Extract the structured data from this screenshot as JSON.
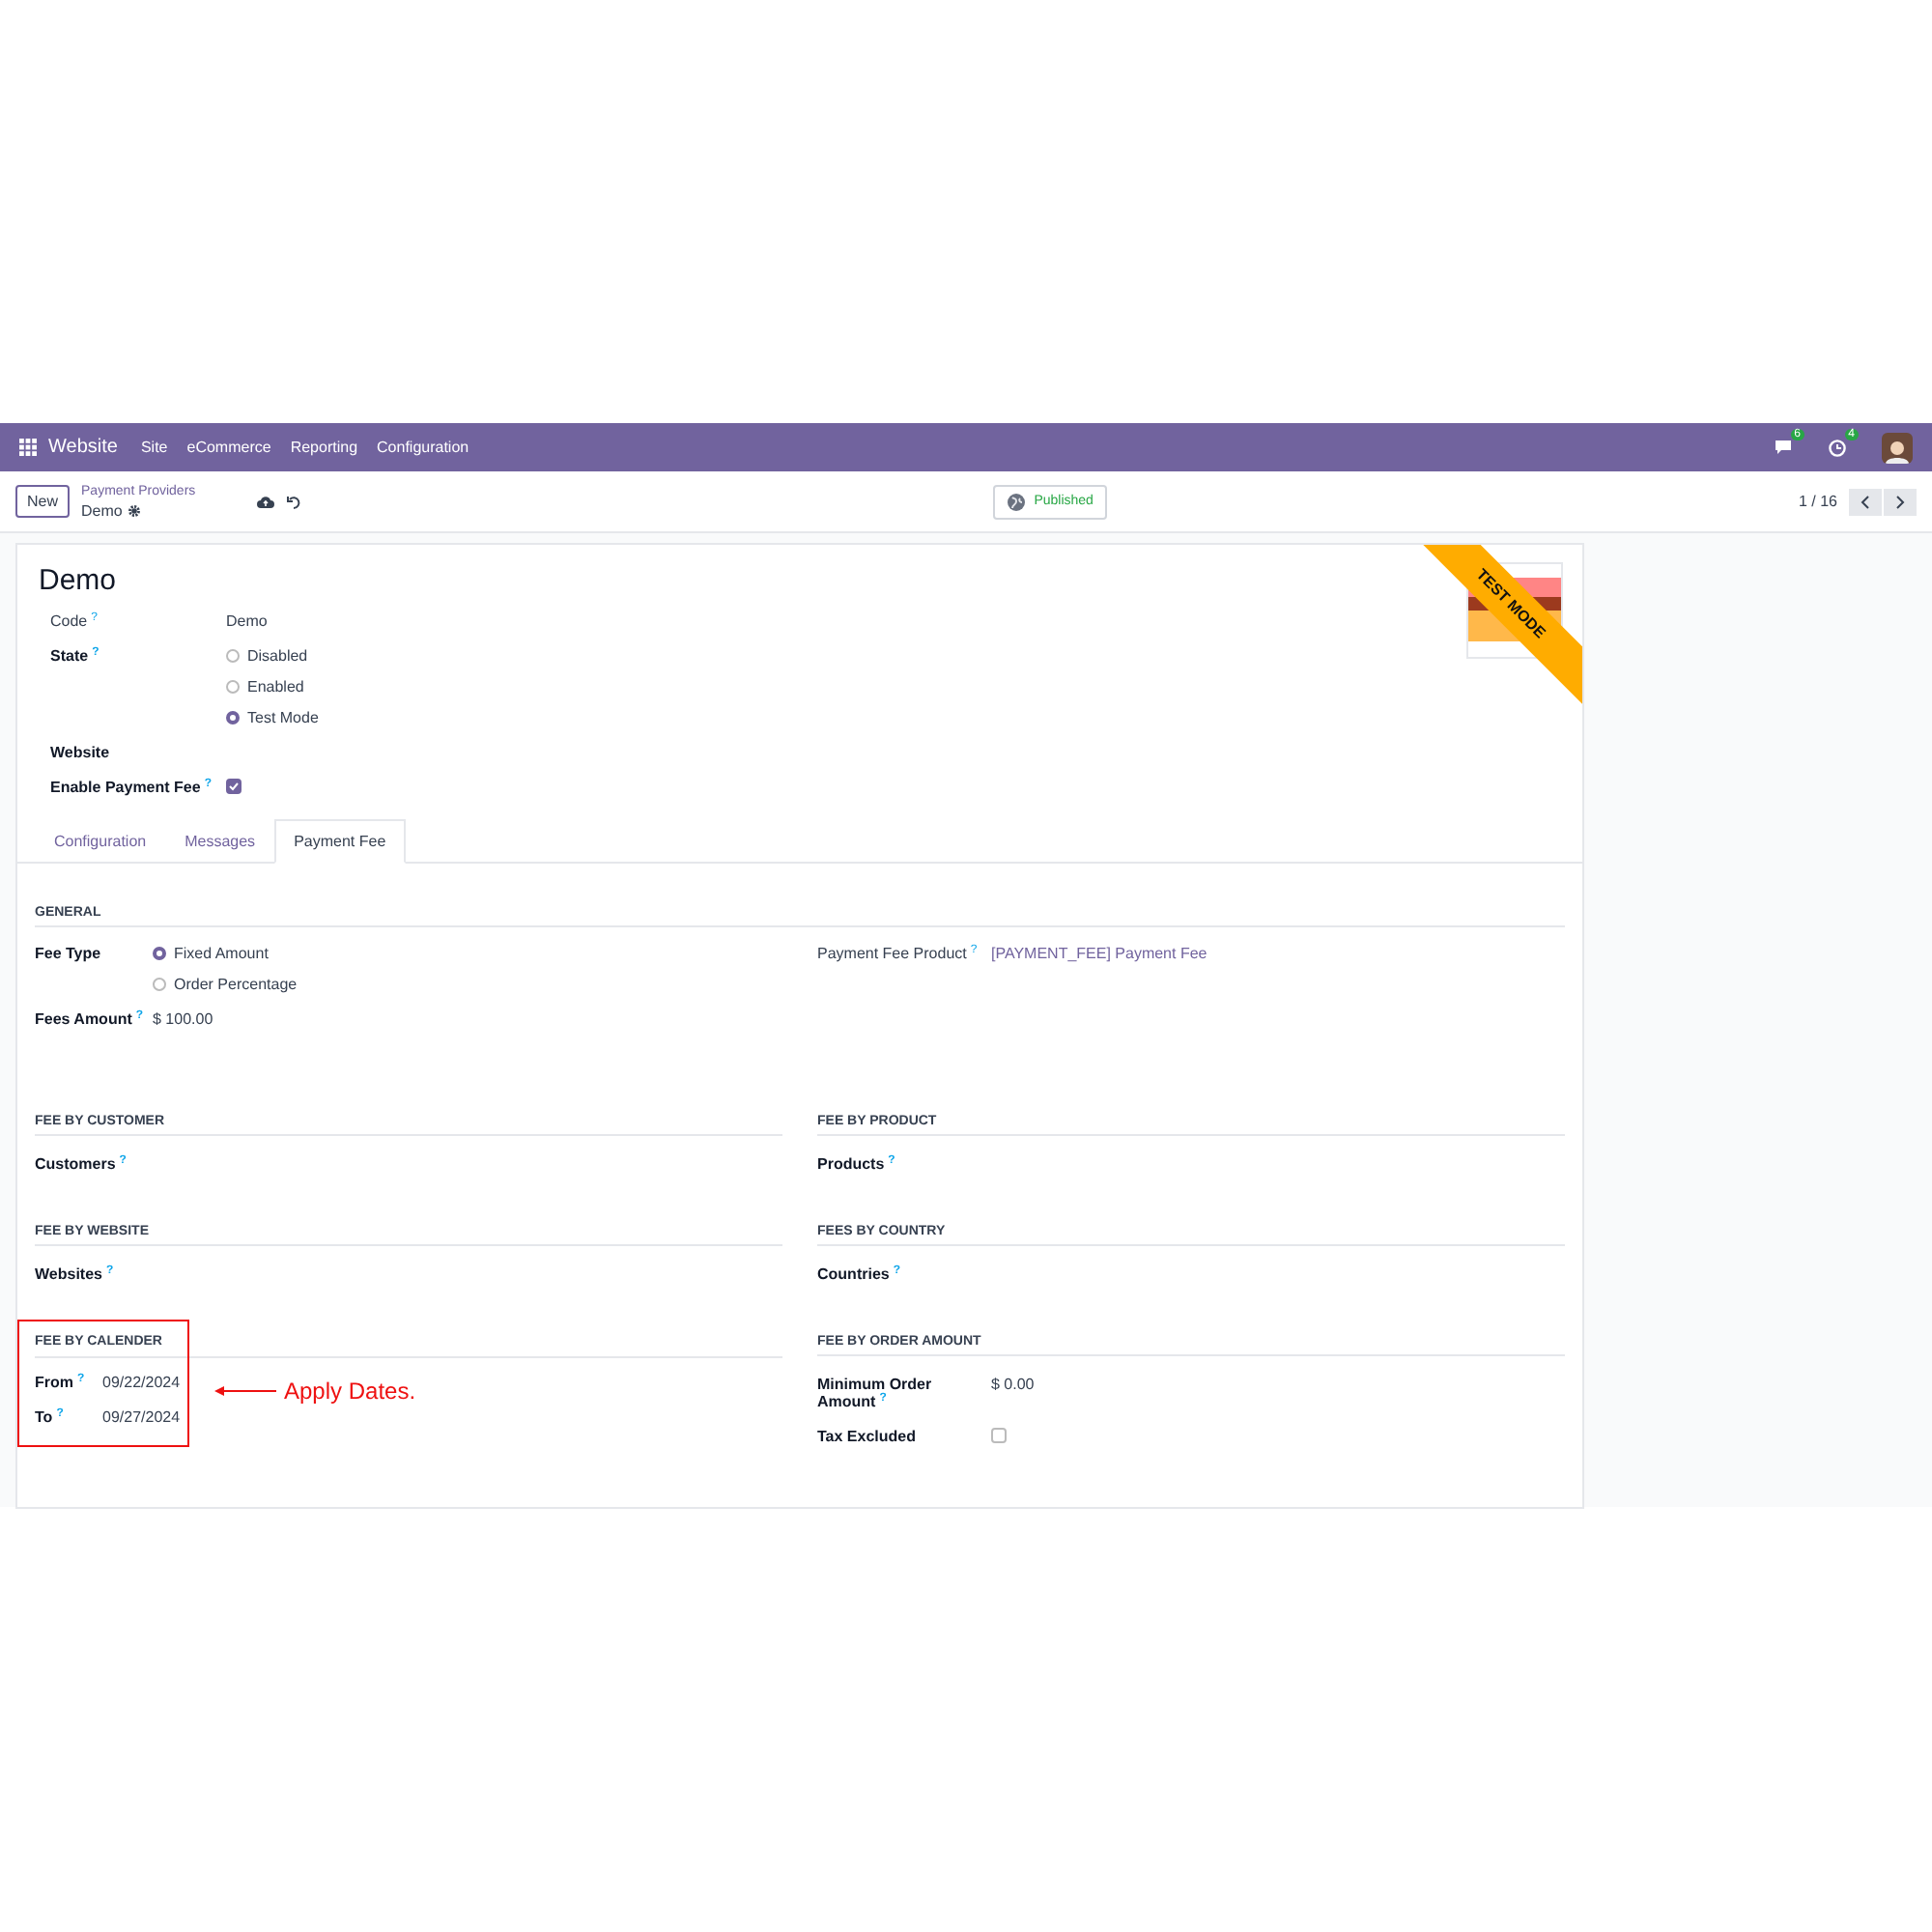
{
  "navbar": {
    "app": "Website",
    "menu": [
      "Site",
      "eCommerce",
      "Reporting",
      "Configuration"
    ],
    "messages_count": "6",
    "activities_count": "4"
  },
  "control_bar": {
    "new_button": "New",
    "breadcrumb": "Payment Providers",
    "record": "Demo",
    "status_button": "Published",
    "pager": "1 / 16"
  },
  "form": {
    "title": "Demo",
    "ribbon": "TEST MODE",
    "fields": [
      {
        "kind": "text",
        "label": "Code",
        "help": "?",
        "bold": false,
        "value": "Demo"
      },
      {
        "kind": "radio",
        "label": "State",
        "help": "?",
        "bold": true,
        "options": [
          {
            "label": "Disabled",
            "selected": false
          },
          {
            "label": "Enabled",
            "selected": false
          },
          {
            "label": "Test Mode",
            "selected": true
          }
        ]
      },
      {
        "kind": "empty",
        "label": "Website",
        "bold": true
      },
      {
        "kind": "checkbox",
        "label": "Enable Payment Fee",
        "help": "?",
        "bold": true,
        "checked": true
      }
    ],
    "tabs": [
      {
        "label": "Configuration",
        "selected": false
      },
      {
        "label": "Messages",
        "selected": false
      },
      {
        "label": "Payment Fee",
        "selected": true
      }
    ],
    "general": {
      "title": "GENERAL",
      "left": [
        {
          "kind": "radio",
          "label": "Fee Type",
          "bold": true,
          "options": [
            {
              "label": "Fixed Amount",
              "selected": true
            },
            {
              "label": "Order Percentage",
              "selected": false
            }
          ]
        },
        {
          "kind": "text",
          "label": "Fees Amount",
          "help": "?",
          "bold": true,
          "value": "$ 100.00"
        }
      ],
      "right": [
        {
          "kind": "link",
          "label": "Payment Fee Product",
          "help": "?",
          "bold": false,
          "value": "[PAYMENT_FEE] Payment Fee"
        }
      ]
    },
    "sections": [
      {
        "title": "FEE BY CUSTOMER",
        "highlighted": false,
        "fields": [
          {
            "kind": "empty",
            "label": "Customers",
            "help": "?",
            "bold": true
          }
        ]
      },
      {
        "title": "FEE BY PRODUCT",
        "highlighted": false,
        "fields": [
          {
            "kind": "empty",
            "label": "Products",
            "help": "?",
            "bold": true
          }
        ]
      },
      {
        "title": "FEE BY WEBSITE",
        "highlighted": false,
        "fields": [
          {
            "kind": "empty",
            "label": "Websites",
            "help": "?",
            "bold": true
          }
        ]
      },
      {
        "title": "FEES BY COUNTRY",
        "highlighted": false,
        "fields": [
          {
            "kind": "empty",
            "label": "Countries",
            "help": "?",
            "bold": true
          }
        ]
      },
      {
        "title": "FEE BY CALENDER",
        "highlighted": true,
        "callout": "Apply Dates.",
        "fields": [
          {
            "kind": "text",
            "label": "From",
            "help": "?",
            "bold": true,
            "value": "09/22/2024"
          },
          {
            "kind": "text",
            "label": "To",
            "help": "?",
            "bold": true,
            "value": "09/27/2024"
          }
        ]
      },
      {
        "title": "FEE BY ORDER AMOUNT",
        "highlighted": false,
        "fields": [
          {
            "kind": "text",
            "label": "Minimum Order Amount",
            "help": "?",
            "bold": true,
            "value": "$ 0.00"
          },
          {
            "kind": "checkbox",
            "label": "Tax Excluded",
            "bold": true,
            "checked": false
          }
        ]
      }
    ]
  }
}
